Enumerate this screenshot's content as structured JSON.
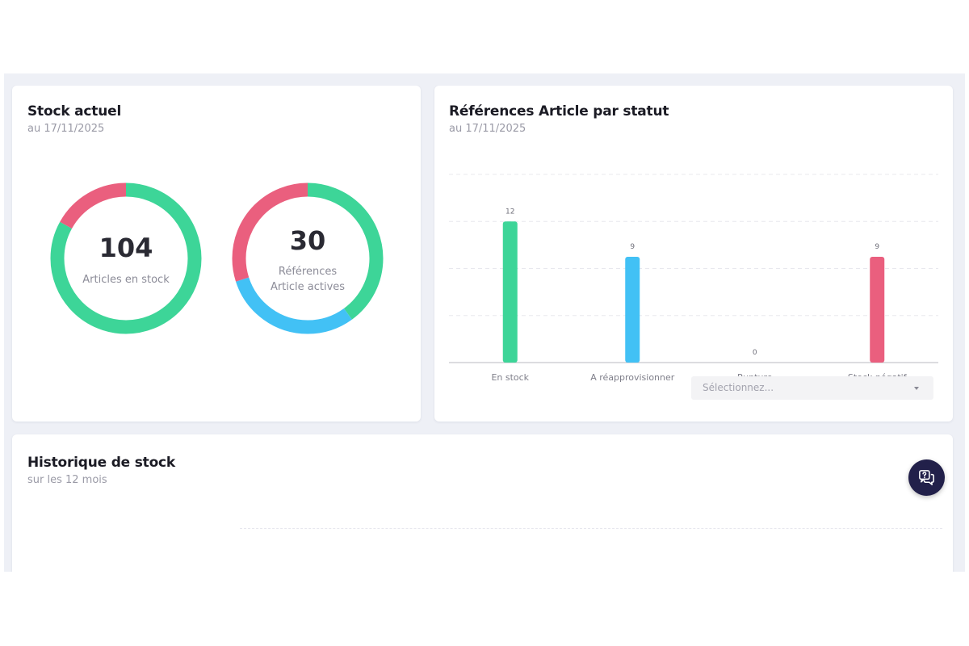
{
  "stock_card": {
    "title": "Stock actuel",
    "subtitle": "au 17/11/2025",
    "donut_articles": {
      "value": "104",
      "label": "Articles en stock",
      "segments": [
        {
          "name": "En stock",
          "fraction": 0.83,
          "color": "#3dd598"
        },
        {
          "name": "Stock négatif",
          "fraction": 0.17,
          "color": "#ea5f7e"
        }
      ]
    },
    "donut_references": {
      "value": "30",
      "label_line1": "Références",
      "label_line2": "Article actives",
      "segments": [
        {
          "name": "En stock",
          "fraction": 0.4,
          "color": "#3dd598"
        },
        {
          "name": "A réapprovisionner",
          "fraction": 0.3,
          "color": "#42c1f5"
        },
        {
          "name": "Stock négatif",
          "fraction": 0.3,
          "color": "#ea5f7e"
        }
      ]
    }
  },
  "status_card": {
    "title": "Références Article par statut",
    "subtitle": "au 17/11/2025"
  },
  "history_card": {
    "title": "Historique de stock",
    "subtitle": "sur les 12 mois",
    "select_placeholder": "Sélectionnez..."
  },
  "help_button": {
    "icon": "chat-question-icon"
  },
  "chart_data": {
    "type": "bar",
    "categories": [
      "En stock",
      "A réapprovisionner",
      "Rupture",
      "Stock négatif"
    ],
    "values": [
      12,
      9,
      0,
      9
    ],
    "value_labels": [
      "12",
      "9",
      "0",
      "9"
    ],
    "colors": [
      "#3dd598",
      "#42c1f5",
      "#ea5f7e",
      "#ea5f7e"
    ],
    "ylim": [
      0,
      16
    ],
    "grid": "horizontal-dashed",
    "legend": "none"
  }
}
